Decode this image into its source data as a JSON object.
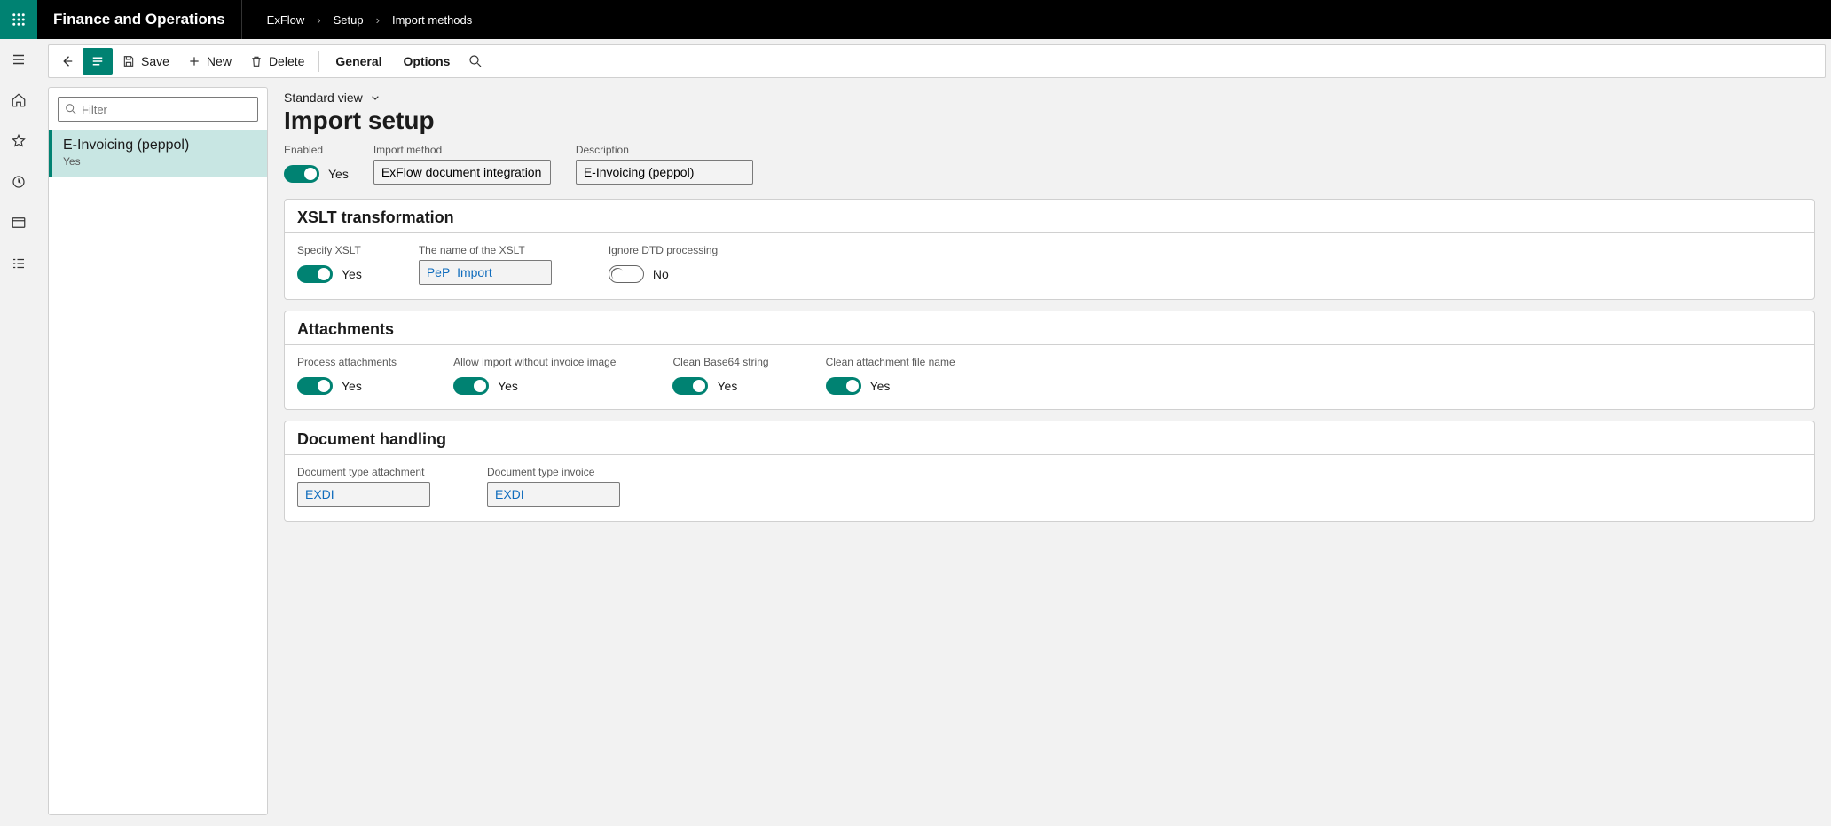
{
  "app_title": "Finance and Operations",
  "breadcrumbs": [
    "ExFlow",
    "Setup",
    "Import methods"
  ],
  "commands": {
    "save": "Save",
    "new": "New",
    "delete": "Delete",
    "tabs": {
      "general": "General",
      "options": "Options"
    }
  },
  "filter": {
    "placeholder": "Filter"
  },
  "list": [
    {
      "title": "E-Invoicing (peppol)",
      "subtitle": "Yes",
      "selected": true
    }
  ],
  "detail": {
    "view_label": "Standard view",
    "page_title": "Import setup",
    "top_fields": {
      "enabled": {
        "label": "Enabled",
        "value": true,
        "text": "Yes"
      },
      "import_method": {
        "label": "Import method",
        "value": "ExFlow document integration"
      },
      "description": {
        "label": "Description",
        "value": "E-Invoicing (peppol)"
      }
    },
    "sections": {
      "xslt": {
        "title": "XSLT transformation",
        "specify_xslt": {
          "label": "Specify XSLT",
          "value": true,
          "text": "Yes"
        },
        "xslt_name": {
          "label": "The name of the XSLT",
          "value": "PeP_Import"
        },
        "ignore_dtd": {
          "label": "Ignore DTD processing",
          "value": false,
          "text": "No"
        }
      },
      "attachments": {
        "title": "Attachments",
        "process": {
          "label": "Process attachments",
          "value": true,
          "text": "Yes"
        },
        "allow_no_image": {
          "label": "Allow import without invoice image",
          "value": true,
          "text": "Yes"
        },
        "clean_b64": {
          "label": "Clean Base64 string",
          "value": true,
          "text": "Yes"
        },
        "clean_name": {
          "label": "Clean attachment file name",
          "value": true,
          "text": "Yes"
        }
      },
      "doc_handling": {
        "title": "Document handling",
        "doc_type_attachment": {
          "label": "Document type attachment",
          "value": "EXDI"
        },
        "doc_type_invoice": {
          "label": "Document type invoice",
          "value": "EXDI"
        }
      }
    }
  }
}
